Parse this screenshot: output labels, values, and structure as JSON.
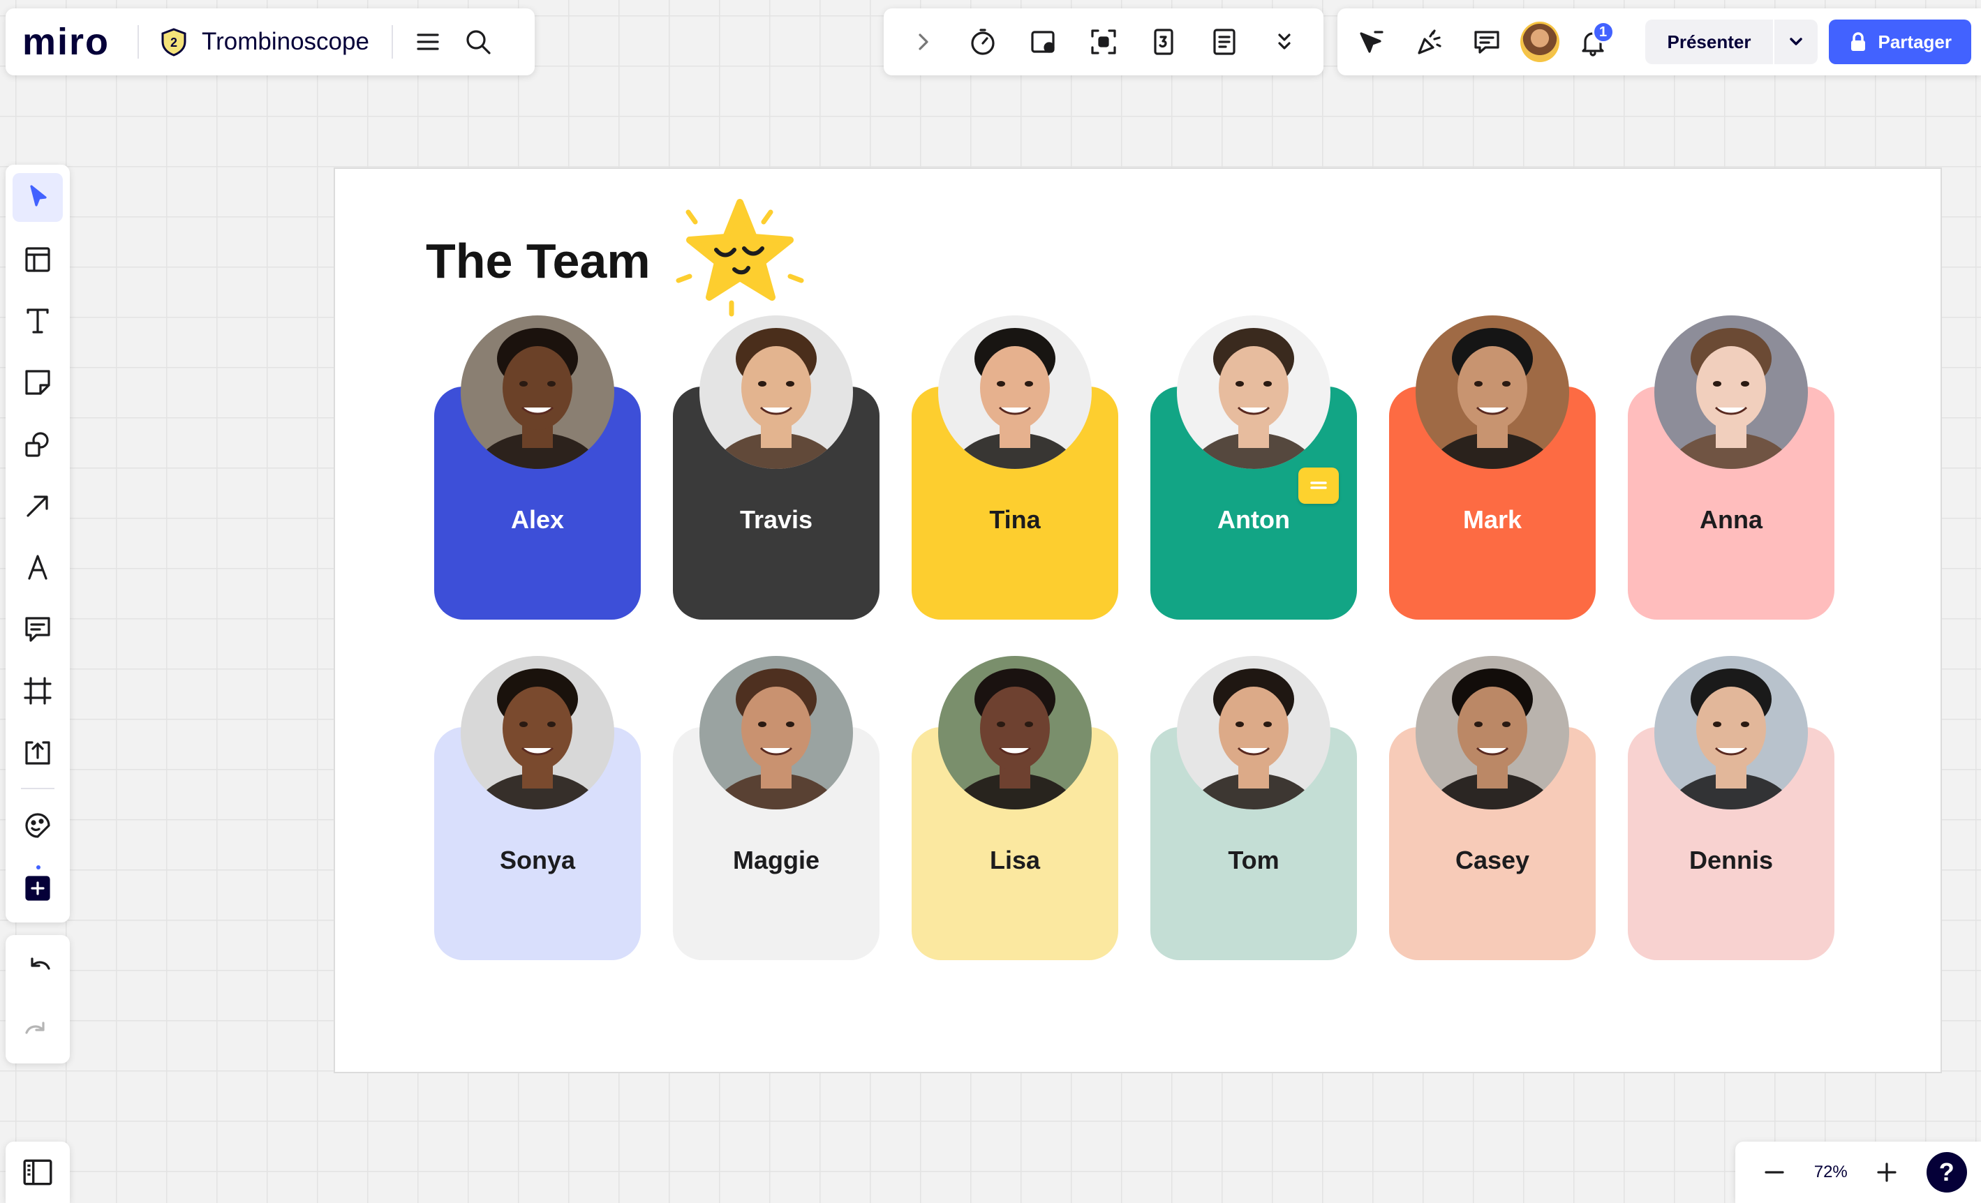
{
  "app": {
    "logo": "miro",
    "board_title": "Trombinoscope",
    "badge_level": "2"
  },
  "header": {
    "present_label": "Présenter",
    "share_label": "Partager",
    "notification_count": "1"
  },
  "zoom": {
    "level": "72%",
    "help": "?"
  },
  "frame": {
    "title": "The Team",
    "row1": [
      {
        "name": "Alex",
        "card_color": "#3d4fd8",
        "text_color": "#ffffff",
        "skin": "#6b4128",
        "hair": "#1b120d",
        "bg": "#8a7f72"
      },
      {
        "name": "Travis",
        "card_color": "#3a3a3a",
        "text_color": "#ffffff",
        "skin": "#e3b48f",
        "hair": "#4a2e1b",
        "bg": "#e4e4e4"
      },
      {
        "name": "Tina",
        "card_color": "#fdce2f",
        "text_color": "#1c1c1e",
        "skin": "#e6b18e",
        "hair": "#181512",
        "bg": "#eeeeee"
      },
      {
        "name": "Anton",
        "card_color": "#12a585",
        "text_color": "#ffffff",
        "skin": "#e7bc9e",
        "hair": "#3a2a1e",
        "bg": "#f2f2f2"
      },
      {
        "name": "Mark",
        "card_color": "#fd6b43",
        "text_color": "#ffffff",
        "skin": "#c89470",
        "hair": "#151515",
        "bg": "#9f6a45"
      },
      {
        "name": "Anna",
        "card_color": "#ffbdbd",
        "text_color": "#1c1c1e",
        "skin": "#f1cfbd",
        "hair": "#6b4a34",
        "bg": "#8d8d99"
      }
    ],
    "row2": [
      {
        "name": "Sonya",
        "card_color": "#d9dffc",
        "text_color": "#1c1c1e",
        "skin": "#7a4a2e",
        "hair": "#1a120c",
        "bg": "#d8d8d8"
      },
      {
        "name": "Maggie",
        "card_color": "#f1f1f1",
        "text_color": "#1c1c1e",
        "skin": "#c99270",
        "hair": "#4e3020",
        "bg": "#9aa3a1"
      },
      {
        "name": "Lisa",
        "card_color": "#fbe8a0",
        "text_color": "#1c1c1e",
        "skin": "#6e4130",
        "hair": "#1a1210",
        "bg": "#7a8f6c"
      },
      {
        "name": "Tom",
        "card_color": "#c4ded5",
        "text_color": "#1c1c1e",
        "skin": "#dcaa88",
        "hair": "#1f1712",
        "bg": "#e6e6e6"
      },
      {
        "name": "Casey",
        "card_color": "#f7cbb8",
        "text_color": "#1c1c1e",
        "skin": "#bb8866",
        "hair": "#120d0a",
        "bg": "#b9b3ad"
      },
      {
        "name": "Dennis",
        "card_color": "#f8d2d0",
        "text_color": "#1c1c1e",
        "skin": "#e2b79a",
        "hair": "#1a1a1a",
        "bg": "#b8c2cc"
      }
    ]
  },
  "icons": {
    "toolbar_left": [
      "select-arrow-icon",
      "templates-icon",
      "text-icon",
      "sticky-note-icon",
      "shapes-icon",
      "connector-arrow-icon",
      "pen-icon",
      "comment-icon",
      "frame-icon",
      "upload-icon",
      "stickers-icon",
      "more-apps-icon"
    ],
    "toolbar_top_middle": [
      "chevron-right-icon",
      "timer-icon",
      "presentation-mode-icon",
      "focus-icon",
      "voting-icon",
      "notes-icon",
      "chevron-double-down-icon"
    ],
    "toolbar_top_right": [
      "cursor-icon",
      "reactions-icon",
      "chat-icon",
      "user-avatar",
      "bell-icon"
    ]
  }
}
